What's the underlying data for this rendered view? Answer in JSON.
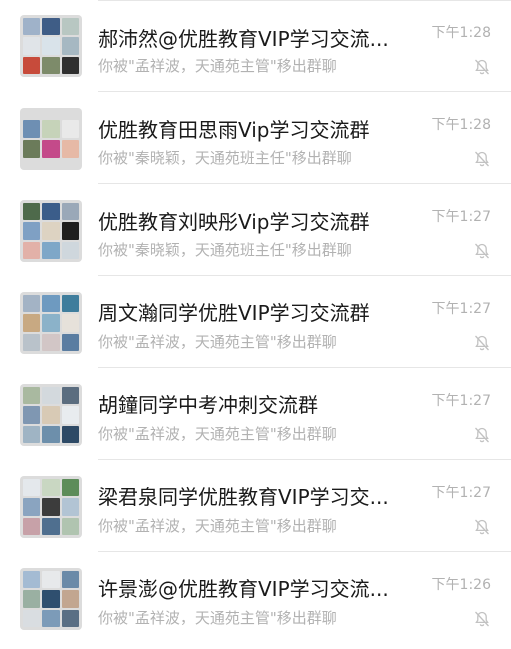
{
  "chats": [
    {
      "title": "郝沛然@优胜教育VIP学习交流...",
      "subtitle": "你被\"孟祥波，天通苑主管\"移出群聊",
      "time": "下午1:28",
      "muted": true,
      "avatar_colors": [
        "#9fb2c9",
        "#3f5d86",
        "#b8c7c2",
        "#e0e4e8",
        "#d9e3ea",
        "#a6b8c2",
        "#c74b3b",
        "#7d8b6a",
        "#2f2f2f"
      ]
    },
    {
      "title": "优胜教育田思雨Vip学习交流群",
      "subtitle": "你被\"秦晓颖，天通苑班主任\"移出群聊",
      "time": "下午1:28",
      "muted": true,
      "avatar_colors": [
        "#6e8fb3",
        "#c6d3b9",
        "#e9e9e9",
        "#6b7b5a",
        "#c44a8a",
        "#e6b9a6"
      ]
    },
    {
      "title": "优胜教育刘映彤Vip学习交流群",
      "subtitle": "你被\"秦晓颖，天通苑班主任\"移出群聊",
      "time": "下午1:27",
      "muted": true,
      "avatar_colors": [
        "#4e6a4b",
        "#3b5d8a",
        "#9aa8b8",
        "#7fa0c4",
        "#ddd3c2",
        "#1f1f1f",
        "#e2b1a8",
        "#7ea7c8",
        "#cfd7dd"
      ]
    },
    {
      "title": "周文瀚同学优胜VIP学习交流群",
      "subtitle": "你被\"孟祥波，天通苑主管\"移出群聊",
      "time": "下午1:27",
      "muted": true,
      "avatar_colors": [
        "#a3b3c5",
        "#6e9ac0",
        "#3f7d9c",
        "#c8a982",
        "#8bb2c9",
        "#e6e1da",
        "#b9c2ca",
        "#d2c6c6",
        "#5a7da1"
      ]
    },
    {
      "title": "胡鐘同学中考冲刺交流群",
      "subtitle": "你被\"孟祥波，天通苑主管\"移出群聊",
      "time": "下午1:27",
      "muted": true,
      "avatar_colors": [
        "#a9b9a0",
        "#d3d9dd",
        "#5b6d7f",
        "#7f97b2",
        "#d8cab5",
        "#e8ecef",
        "#9fb4c4",
        "#6d8fab",
        "#2e4a66"
      ]
    },
    {
      "title": "梁君泉同学优胜教育VIP学习交...",
      "subtitle": "你被\"孟祥波，天通苑主管\"移出群聊",
      "time": "下午1:27",
      "muted": true,
      "avatar_colors": [
        "#e4e8ec",
        "#c9d7c2",
        "#5d8c5a",
        "#8aa4c0",
        "#3c3c3c",
        "#b2c4d4",
        "#c7a1a8",
        "#4f6f8f",
        "#b0c4b0"
      ]
    },
    {
      "title": "许景澎@优胜教育VIP学习交流...",
      "subtitle": "你被\"孟祥波，天通苑主管\"移出群聊",
      "time": "下午1:26",
      "muted": true,
      "avatar_colors": [
        "#a4bbd3",
        "#e7e9eb",
        "#6a8aa8",
        "#9ab0a2",
        "#2f4f6f",
        "#c2a690",
        "#d9dde1",
        "#7c9bb8",
        "#5a6f84"
      ]
    }
  ]
}
